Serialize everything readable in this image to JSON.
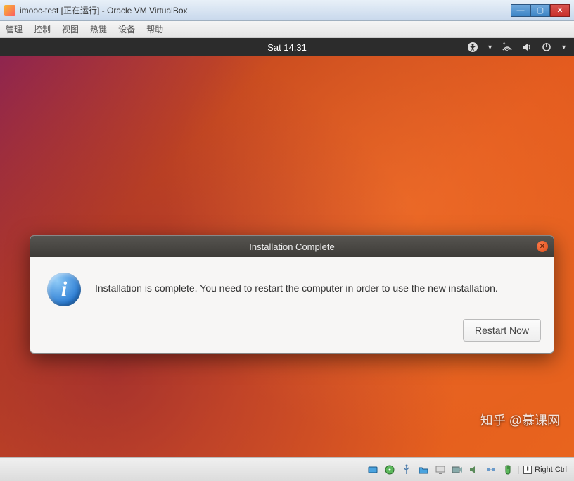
{
  "window": {
    "title": "imooc-test [正在运行] - Oracle VM VirtualBox",
    "min": "—",
    "max": "▢",
    "close": "✕"
  },
  "vbox_menu": [
    "管理",
    "控制",
    "视图",
    "热键",
    "设备",
    "帮助"
  ],
  "ubuntu": {
    "time": "Sat 14:31"
  },
  "dialog": {
    "title": "Installation Complete",
    "message": "Installation is complete. You need to restart the computer in order to use the new installation.",
    "button": "Restart Now",
    "info_glyph": "i"
  },
  "statusbar": {
    "host_key": "Right Ctrl"
  },
  "watermark": "知乎 @慕课网"
}
